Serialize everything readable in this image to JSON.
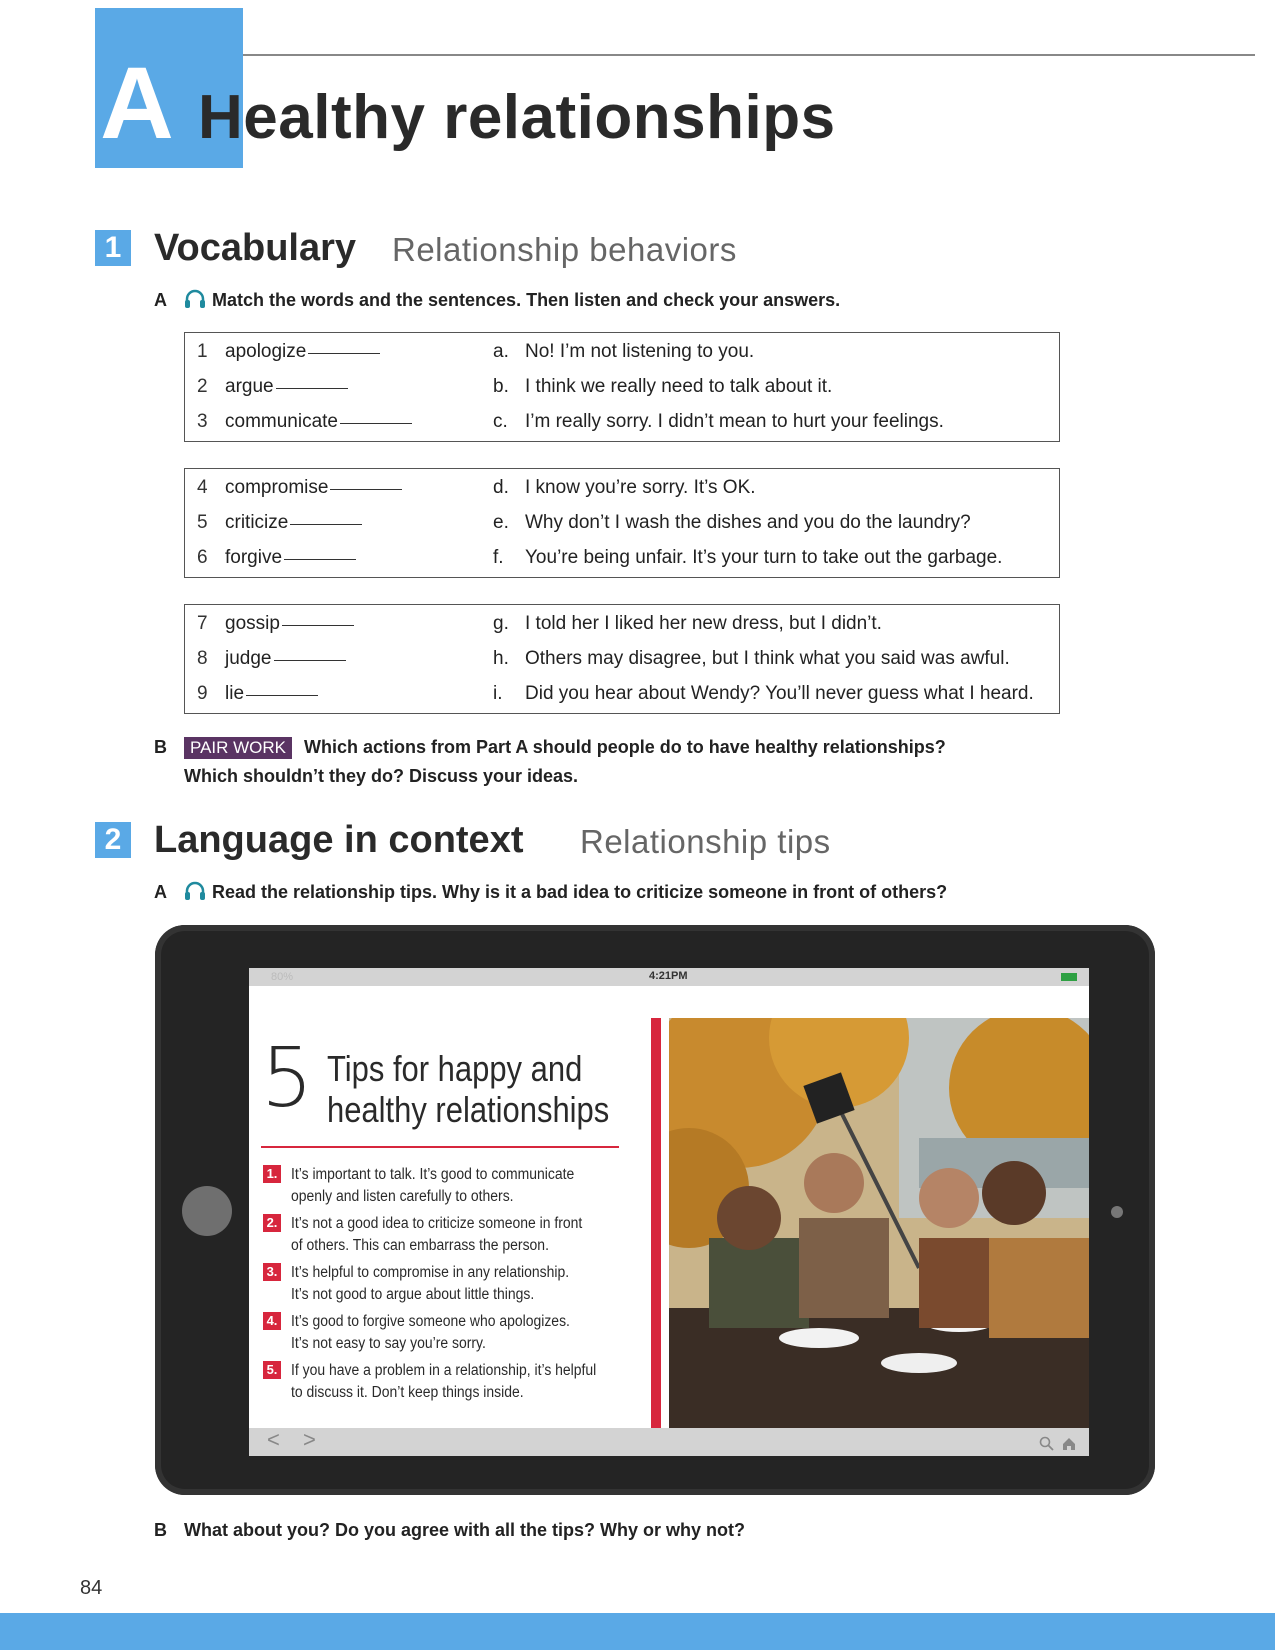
{
  "header": {
    "unit_letter": "A",
    "title": "Healthy relationships"
  },
  "vocabulary": {
    "number": "1",
    "title": "Vocabulary",
    "subtitle": "Relationship behaviors",
    "part_a": {
      "letter": "A",
      "instruction": "Match the words and the sentences. Then listen and check your answers.",
      "icon": "headphones-icon"
    },
    "groups": [
      {
        "words": [
          {
            "num": "1",
            "word": "apologize"
          },
          {
            "num": "2",
            "word": "argue"
          },
          {
            "num": "3",
            "word": "communicate"
          }
        ],
        "sentences": [
          {
            "letter": "a.",
            "text": "No! I’m not listening to you."
          },
          {
            "letter": "b.",
            "text": "I think we really need to talk about it."
          },
          {
            "letter": "c.",
            "text": "I’m really sorry. I didn’t mean to hurt your feelings."
          }
        ]
      },
      {
        "words": [
          {
            "num": "4",
            "word": "compromise"
          },
          {
            "num": "5",
            "word": "criticize"
          },
          {
            "num": "6",
            "word": "forgive"
          }
        ],
        "sentences": [
          {
            "letter": "d.",
            "text": "I know you’re sorry. It’s OK."
          },
          {
            "letter": "e.",
            "text": "Why don’t I wash the dishes and you do the laundry?"
          },
          {
            "letter": "f.",
            "text": "You’re being unfair. It’s your turn to take out the garbage."
          }
        ]
      },
      {
        "words": [
          {
            "num": "7",
            "word": "gossip"
          },
          {
            "num": "8",
            "word": "judge"
          },
          {
            "num": "9",
            "word": "lie"
          }
        ],
        "sentences": [
          {
            "letter": "g.",
            "text": "I told her I liked her new dress, but I didn’t."
          },
          {
            "letter": "h.",
            "text": "Others may disagree, but I think what you said was awful."
          },
          {
            "letter": "i.",
            "text": "Did you hear about Wendy? You’ll never guess what I heard."
          }
        ]
      }
    ],
    "part_b": {
      "letter": "B",
      "badge": "PAIR WORK",
      "line1": "Which actions from Part A should people do to have healthy relationships?",
      "line2": "Which shouldn’t they do? Discuss your ideas."
    }
  },
  "language": {
    "number": "2",
    "title": "Language in context",
    "subtitle": "Relationship tips",
    "part_a": {
      "letter": "A",
      "instruction": "Read the relationship tips. Why is it a bad idea to criticize someone in front of others?",
      "icon": "headphones-icon"
    },
    "tablet": {
      "status_battery": "80%",
      "status_time": "4:21PM",
      "tips_number": "5",
      "tips_title_line1": "Tips for happy and",
      "tips_title_line2": "healthy relationships",
      "tips": [
        {
          "num": "1.",
          "line1": "It’s important to talk. It’s good to communicate",
          "line2": "openly and listen carefully to others."
        },
        {
          "num": "2.",
          "line1": "It’s not a good idea to criticize someone in front",
          "line2": "of others. This can embarrass the person."
        },
        {
          "num": "3.",
          "line1": "It’s helpful to compromise in any relationship.",
          "line2": "It’s not good to argue about little things."
        },
        {
          "num": "4.",
          "line1": "It’s good to forgive someone who apologizes.",
          "line2": "It’s not easy to say you’re sorry."
        },
        {
          "num": "5.",
          "line1": "If you have a problem in a relationship, it’s helpful",
          "line2": "to discuss it. Don’t keep things inside."
        }
      ],
      "nav_back": "<",
      "nav_forward": ">"
    },
    "part_b": {
      "letter": "B",
      "text": "What about you? Do you agree with all the tips? Why or why not?"
    }
  },
  "footer": {
    "page_number": "84"
  },
  "colors": {
    "accent_blue": "#5aa9e6",
    "tip_red": "#d7263d",
    "pair_work_purple": "#5a3463"
  }
}
